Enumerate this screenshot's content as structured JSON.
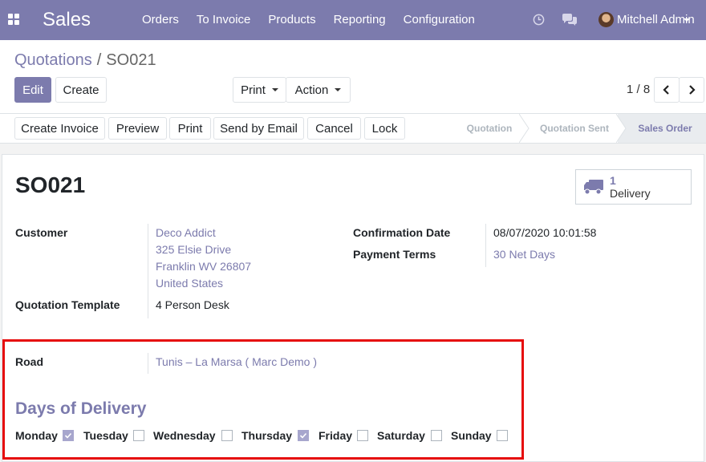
{
  "navbar": {
    "app_title": "Sales",
    "menu": [
      "Orders",
      "To Invoice",
      "Products",
      "Reporting",
      "Configuration"
    ],
    "user_name": "Mitchell Admin",
    "icons": [
      "apps-icon",
      "clock-icon",
      "chat-icon"
    ],
    "color": "#7c7bad"
  },
  "breadcrumb": {
    "parent": "Quotations",
    "separator": "/",
    "current": "SO021"
  },
  "toolbar": {
    "edit_label": "Edit",
    "create_label": "Create",
    "print_label": "Print",
    "action_label": "Action"
  },
  "pager": {
    "value": "1 / 8"
  },
  "statusbar": {
    "buttons": [
      "Create Invoice",
      "Preview",
      "Print",
      "Send by Email",
      "Cancel",
      "Lock"
    ],
    "stages": [
      "Quotation",
      "Quotation Sent",
      "Sales Order"
    ],
    "active_stage": "Sales Order"
  },
  "record": {
    "name": "SO021",
    "smart_button": {
      "count": "1",
      "label": "Delivery",
      "icon": "truck-icon"
    },
    "customer_label": "Customer",
    "customer_name": "Deco Addict",
    "address": [
      "325 Elsie Drive",
      "Franklin WV 26807",
      "United States"
    ],
    "confirmation_label": "Confirmation Date",
    "confirmation_value": "08/07/2020 10:01:58",
    "payment_terms_label": "Payment Terms",
    "payment_terms_value": "30 Net Days",
    "template_label": "Quotation Template",
    "template_value": "4 Person Desk",
    "road_label": "Road",
    "road_value": "Tunis – La Marsa ( Marc Demo )",
    "days_title": "Days of Delivery",
    "days": [
      {
        "label": "Monday",
        "checked": true
      },
      {
        "label": "Tuesday",
        "checked": false
      },
      {
        "label": "Wednesday",
        "checked": false
      },
      {
        "label": "Thursday",
        "checked": true
      },
      {
        "label": "Friday",
        "checked": false
      },
      {
        "label": "Saturday",
        "checked": false
      },
      {
        "label": "Sunday",
        "checked": false
      }
    ]
  }
}
